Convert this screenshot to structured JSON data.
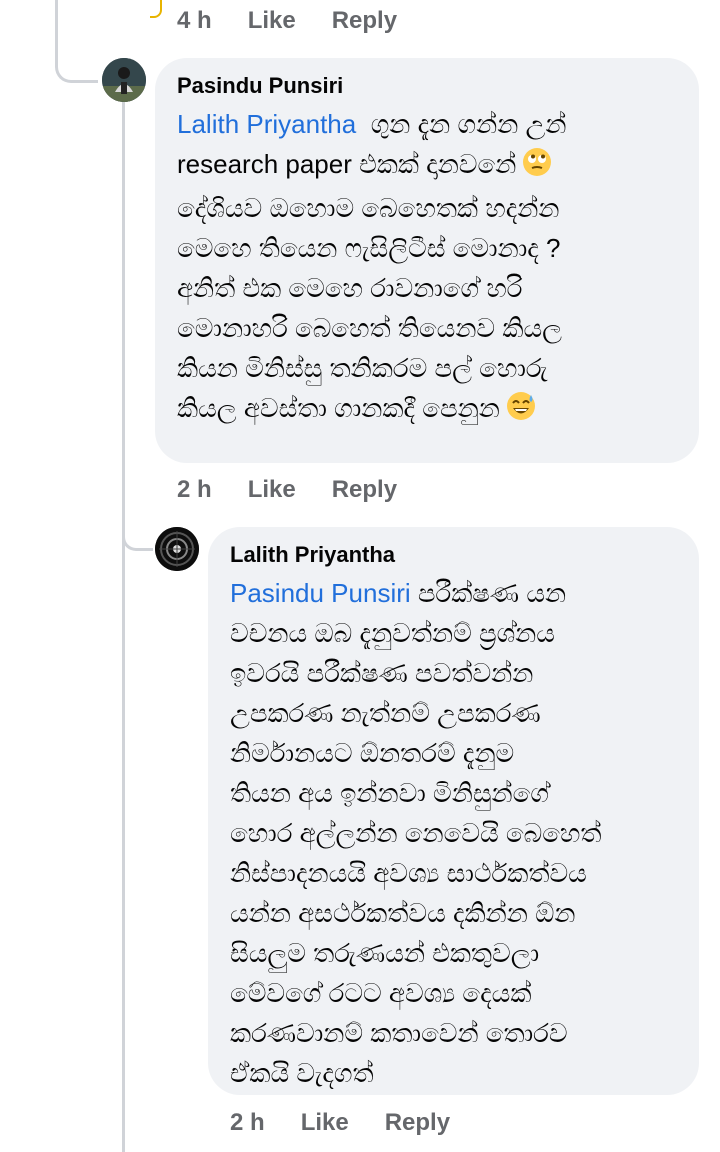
{
  "top_meta": {
    "time": "4 h",
    "like": "Like",
    "reply": "Reply"
  },
  "comments": [
    {
      "author": "Pasindu Punsiri",
      "mention": "Lalith Priyantha",
      "text_lines": [
        "ගුන දැන ගන්න උන්",
        "research paper එකක් දානවනේ",
        "දේශියව ඔහොම බෙහෙතක් හදන්න",
        "මෙහෙ තියෙන ෆැසිලිටීස් මොනාද ?",
        "අනිත් එක මෙහෙ රාවනාගේ හරි",
        "මොනාහරි බෙහෙත් තියෙනව කියල",
        "කියන මිනිස්සු තනිකරම පල් හොරු",
        "කියල අවස්තා ගානකදී පෙනුන"
      ],
      "emoji_1": "eye-roll-emoji",
      "emoji_2": "grin-sweat-emoji",
      "meta": {
        "time": "2 h",
        "like": "Like",
        "reply": "Reply"
      }
    },
    {
      "author": "Lalith Priyantha",
      "mention": "Pasindu Punsiri",
      "text_lines": [
        "පරීක්ෂණ යන",
        "වචනය ඔබ දැනුවත්නම් ප්‍රශ්නය",
        "ඉවරයි පරීක්ෂණ පවත්වන්න",
        "උපකරණ නැත්නම් උපකරණ",
        "නිර්මානයට ඕනතරම් දැනුම",
        "තියන අය ඉන්නවා මිනිසුන්ගේ",
        "හොර අල්ලන්න නෙවෙයි බෙහෙත්",
        "නිස්පාදනයයි අවශ්‍ය සාර්ථකත්වය",
        "යන්න අසර්ථකත්වය දකින්න ඕන",
        "සියලුම තරුණයන් එකතුවලා",
        "මේවගේ රටට අවශ්‍ය දෙයක්",
        "කරණවානම් කතාවෙන් තොරව",
        "ඒකයි වැදගත්"
      ],
      "meta": {
        "time": "2 h",
        "like": "Like",
        "reply": "Reply"
      }
    }
  ]
}
